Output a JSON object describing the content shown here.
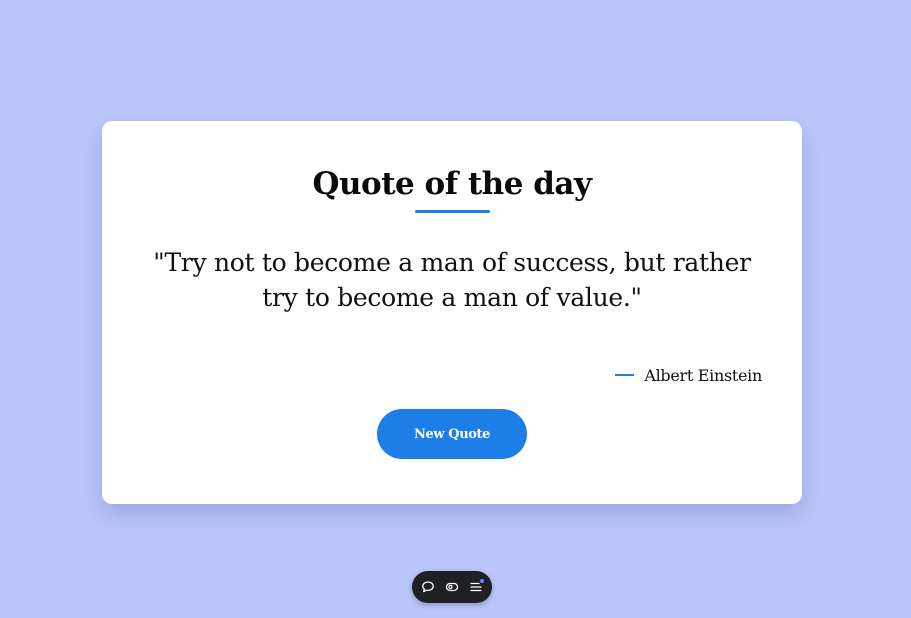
{
  "card": {
    "title": "Quote of the day",
    "quote": "\"Try not to become a man of success, but rather try to become a man of value.\"",
    "author": "Albert Einstein",
    "new_quote_label": "New Quote"
  },
  "toolbar": {
    "buttons": [
      {
        "icon": "comment-icon"
      },
      {
        "icon": "eye-toggle-icon"
      },
      {
        "icon": "menu-icon"
      }
    ]
  },
  "colors": {
    "background": "#bac6fb",
    "accent": "#1e7ee8",
    "card": "#ffffff",
    "toolbar": "#1f2023"
  }
}
